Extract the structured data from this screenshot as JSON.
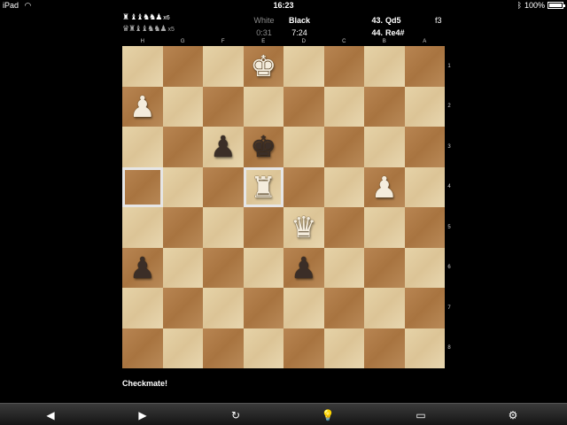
{
  "status_bar": {
    "device": "iPad",
    "time": "16:23",
    "battery_text": "100%",
    "battery_fraction": 1.0,
    "wifi_icon": "wifi-icon",
    "bluetooth_icon": "bluetooth-icon"
  },
  "captured": {
    "white_row": {
      "pieces": "♜ ♝♝♞♞",
      "pawn": "♟",
      "count": "x6"
    },
    "black_row": {
      "pieces": "♛♜♝♝♞♞",
      "pawn": "♟",
      "count": "x5"
    }
  },
  "clock": {
    "white_label": "White",
    "white_time": "0:31",
    "black_label": "Black",
    "black_time": "7:24",
    "active": "Black"
  },
  "moves": [
    {
      "number": "43.",
      "white": "Qd5",
      "black": "f3"
    },
    {
      "number": "44.",
      "white": "Re4#",
      "black": ""
    }
  ],
  "board": {
    "orientation": "black-at-bottom",
    "files": [
      "H",
      "G",
      "F",
      "E",
      "D",
      "C",
      "B",
      "A"
    ],
    "ranks": [
      "1",
      "2",
      "3",
      "4",
      "5",
      "6",
      "7",
      "8"
    ],
    "light_color": "#e2cda0",
    "dark_color": "#b07c48",
    "highlight_color": "#e6e6e6",
    "highlighted_squares": [
      "h4",
      "e4"
    ],
    "pieces": [
      {
        "square": "e1",
        "color": "w",
        "type": "K",
        "glyph": "♚"
      },
      {
        "square": "h2",
        "color": "w",
        "type": "P",
        "glyph": "♟"
      },
      {
        "square": "f3",
        "color": "b",
        "type": "P",
        "glyph": "♟"
      },
      {
        "square": "e3",
        "color": "b",
        "type": "K",
        "glyph": "♚"
      },
      {
        "square": "e4",
        "color": "w",
        "type": "R",
        "glyph": "♜"
      },
      {
        "square": "b4",
        "color": "w",
        "type": "P",
        "glyph": "♟"
      },
      {
        "square": "d5",
        "color": "w",
        "type": "Q",
        "glyph": "♛"
      },
      {
        "square": "h6",
        "color": "b",
        "type": "P",
        "glyph": "♟"
      },
      {
        "square": "d6",
        "color": "b",
        "type": "P",
        "glyph": "♟"
      }
    ]
  },
  "message": "Checkmate!",
  "toolbar": {
    "back_icon": "◀",
    "forward_icon": "▶",
    "undo_icon": "↻",
    "hint_icon": "💡",
    "games_icon": "▭",
    "settings_icon": "⚙"
  }
}
